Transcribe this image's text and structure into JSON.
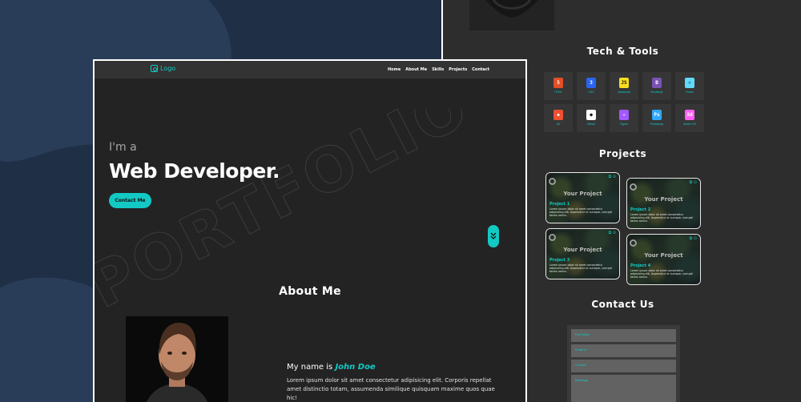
{
  "colors": {
    "accent": "#12c9c4",
    "page_bg": "#1f2f46",
    "blob": "#2a3d58",
    "panel_dark": "#232323",
    "panel_right": "#2d2d2d"
  },
  "hero_page": {
    "nav": {
      "logo_icon": "logo-icon",
      "logo_text": "Logo",
      "links": [
        "Home",
        "About Me",
        "Skills",
        "Projects",
        "Contact"
      ]
    },
    "watermark": "PORTFOLIO",
    "greeting": "I'm a",
    "role": "Web Developer.",
    "cta_label": "Contact Me",
    "scroll_icon": "double-chevron-down-icon",
    "about_heading": "About Me",
    "intro_prefix": "My name is",
    "intro_name": "John Doe",
    "bio": "Lorem ipsum dolor sit amet consectetur adipisicing elit. Corporis repellat amet distinctio totam, assumenda similique quisquam maxime quos quae hic!"
  },
  "scrolled_page": {
    "tools_heading": "Tech & Tools",
    "tools": [
      {
        "label": "HTML",
        "icon": "html5-icon",
        "color": "#e34f26",
        "glyph": "5"
      },
      {
        "label": "CSS",
        "icon": "css3-icon",
        "color": "#2965f1",
        "glyph": "3"
      },
      {
        "label": "Javascript",
        "icon": "javascript-icon",
        "color": "#f7df1e",
        "glyph": "JS"
      },
      {
        "label": "Bootstrap",
        "icon": "bootstrap-icon",
        "color": "#7952b3",
        "glyph": "B"
      },
      {
        "label": "React",
        "icon": "react-icon",
        "color": "#61dafb",
        "glyph": "⚛"
      },
      {
        "label": "Git",
        "icon": "git-icon",
        "color": "#f05032",
        "glyph": "◆"
      },
      {
        "label": "Github",
        "icon": "github-icon",
        "color": "#ffffff",
        "glyph": "●"
      },
      {
        "label": "Figma",
        "icon": "figma-icon",
        "color": "#a259ff",
        "glyph": "✦"
      },
      {
        "label": "Photoshop",
        "icon": "photoshop-icon",
        "color": "#31a8ff",
        "glyph": "Ps"
      },
      {
        "label": "Adobe XD",
        "icon": "adobe-xd-icon",
        "color": "#ff61f6",
        "glyph": "Xd"
      }
    ],
    "projects_heading": "Projects",
    "projects": [
      {
        "title": "Your Project",
        "name": "Project 1",
        "desc": "Lorem ipsum dolor sit amet consectetur adipisicing elit. Aspernatur ut cumque, corrupti totam omnis."
      },
      {
        "title": "Your Project",
        "name": "Project 2",
        "desc": "Lorem ipsum dolor sit amet consectetur adipisicing elit. Aspernatur ut cumque, corrupti totam omnis."
      },
      {
        "title": "Your Project",
        "name": "Project 3",
        "desc": "Lorem ipsum dolor sit amet consectetur adipisicing elit. Aspernatur ut cumque, corrupti totam omnis."
      },
      {
        "title": "Your Project",
        "name": "Project 4",
        "desc": "Lorem ipsum dolor sit amet consectetur adipisicing elit. Aspernatur ut cumque, corrupti totam omnis."
      }
    ],
    "project_link_icons": [
      "external-link-icon",
      "github-icon"
    ],
    "contact_heading": "Contact Us",
    "contact_form": {
      "name_placeholder": "Full Name",
      "email_placeholder": "Email Id",
      "contact_placeholder": "Contact",
      "message_placeholder": "Message"
    }
  }
}
